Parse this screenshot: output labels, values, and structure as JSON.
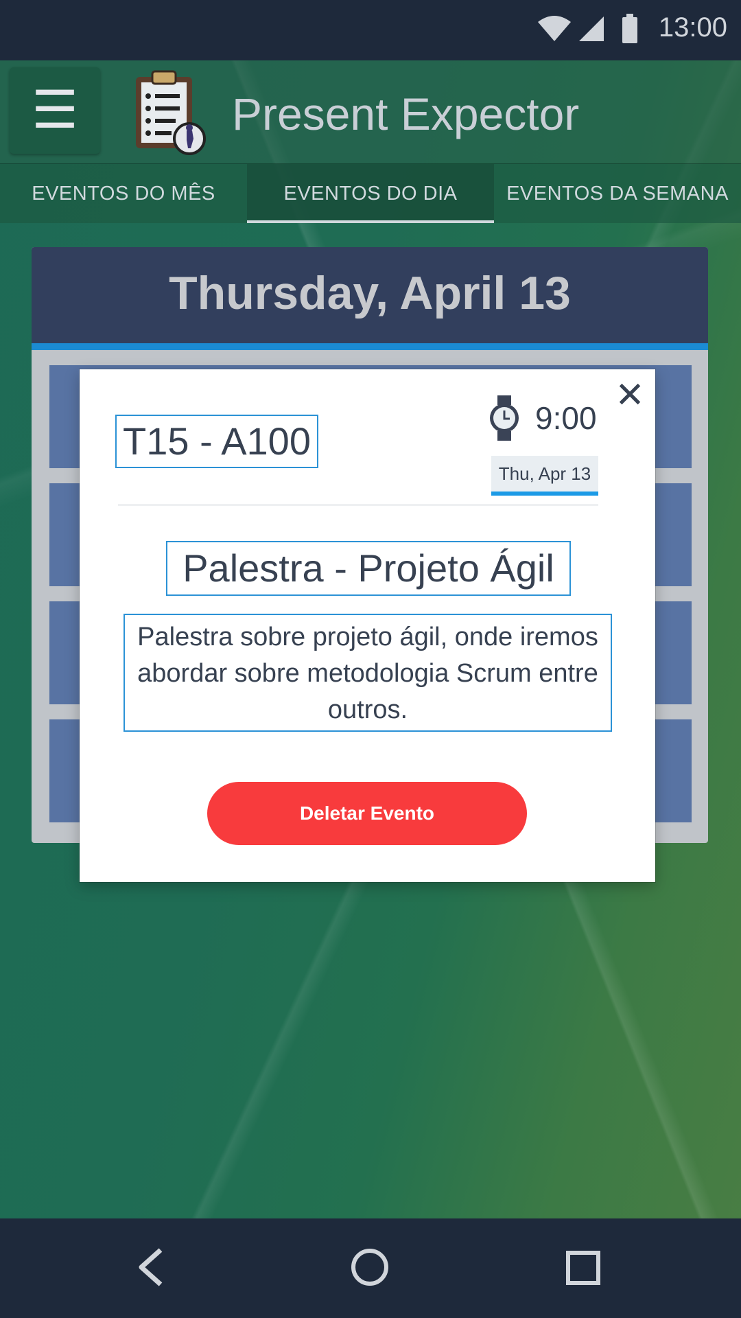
{
  "status_bar": {
    "time": "13:00",
    "icons": [
      "wifi-icon",
      "signal-icon",
      "battery-icon"
    ]
  },
  "app_bar": {
    "menu_icon": "hamburger-icon",
    "logo_icon": "clipboard-checklist-icon",
    "title": "Present Expector"
  },
  "tabs": [
    {
      "label": "EVENTOS DO MÊS",
      "active": false
    },
    {
      "label": "EVENTOS DO DIA",
      "active": true
    },
    {
      "label": "EVENTOS DA SEMANA",
      "active": false
    }
  ],
  "day_view": {
    "date_title": "Thursday, April 13"
  },
  "modal": {
    "close_icon": "close-icon",
    "room": "T15 - A100",
    "time": "9:00",
    "date_chip": "Thu, Apr 13",
    "title": "Palestra - Projeto Ágil",
    "description": "Palestra sobre projeto ágil, onde iremos abordar sobre metodologia Scrum entre outros.",
    "delete_button": "Deletar Evento"
  },
  "nav_bar": {
    "icons": [
      "back-icon",
      "home-icon",
      "recent-apps-icon"
    ]
  },
  "colors": {
    "status_bar": "#1e293b",
    "day_header": "#323f5d",
    "accent_blue": "#1b8bd3",
    "event_row": "#5873a3",
    "delete_red": "#f83b3d"
  }
}
